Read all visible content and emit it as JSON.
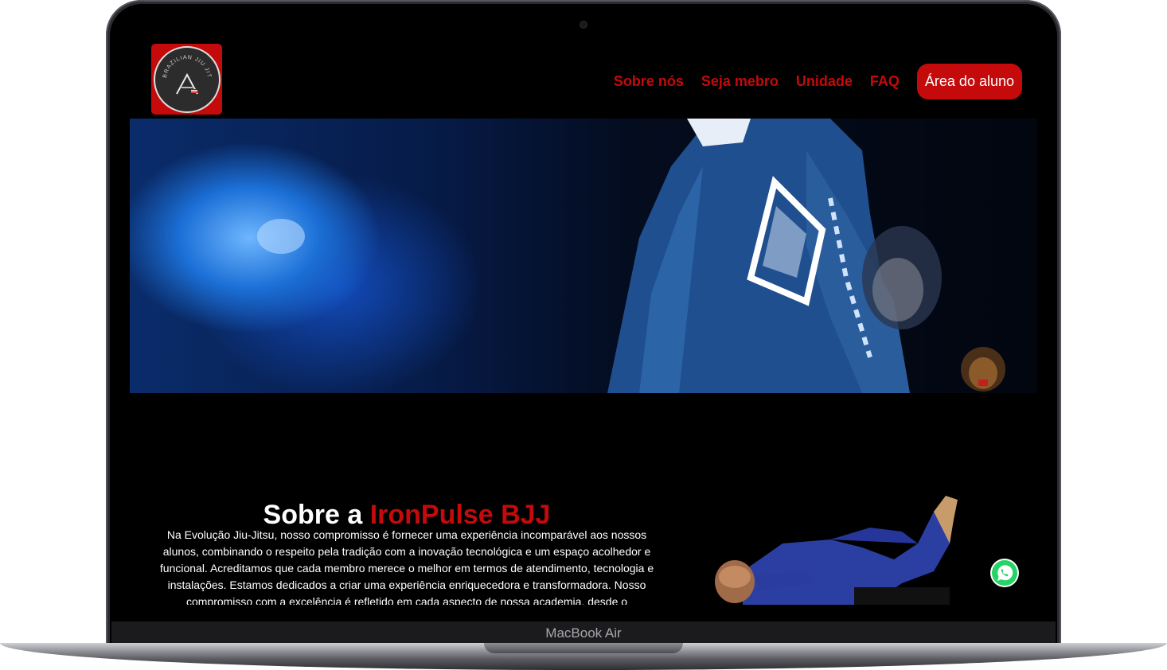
{
  "device": {
    "label": "MacBook Air"
  },
  "site": {
    "logo": {
      "icon": "bjj-logo-icon",
      "ring_text": "BRAZILIAN JIU JITSU",
      "bg_color": "#c40a0a"
    },
    "nav": {
      "items": [
        {
          "label": "Sobre nós"
        },
        {
          "label": "Seja mebro"
        },
        {
          "label": "Unidade"
        },
        {
          "label": "FAQ"
        }
      ],
      "cta_label": "Área do aluno",
      "accent_color": "#c40a0a"
    },
    "hero": {
      "description": "video banner of jiu-jitsu athlete"
    },
    "about": {
      "title_prefix": "Sobre a ",
      "title_accent": "IronPulse BJJ",
      "body": "Na Evolução Jiu-Jitsu, nosso compromisso é fornecer uma experiência incomparável aos nossos alunos, combinando o respeito pela tradição com a inovação tecnológica e um espaço acolhedor e funcional. Acreditamos que cada membro merece o melhor em termos de atendimento, tecnologia e instalações. Estamos dedicados a criar uma experiência enriquecedora e transformadora. Nosso compromisso com a excelência é refletido em cada aspecto de nossa academia, desde o"
    },
    "whatsapp": {
      "icon": "whatsapp-icon",
      "color": "#25d366"
    }
  }
}
